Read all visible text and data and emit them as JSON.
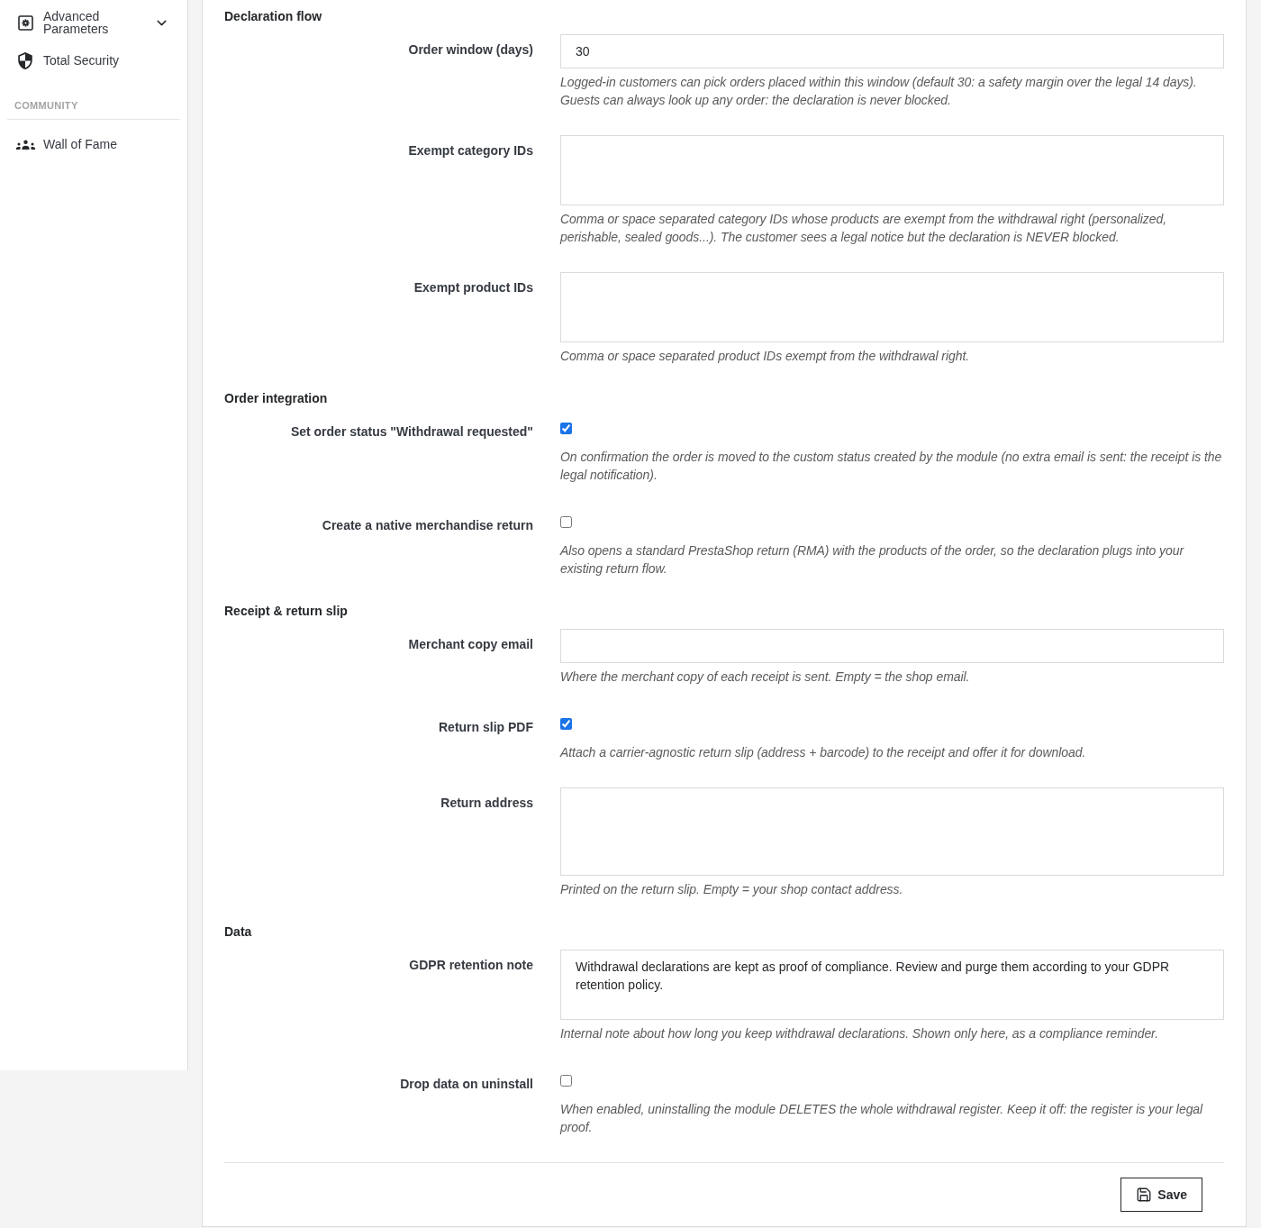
{
  "sidebar": {
    "items": [
      {
        "label": "Advanced Parameters",
        "kind": "group"
      },
      {
        "label": "Total Security",
        "kind": "link"
      }
    ],
    "sections": [
      {
        "title": "COMMUNITY",
        "items": [
          {
            "label": "Wall of Fame",
            "kind": "link"
          }
        ]
      }
    ]
  },
  "form": {
    "sections": [
      {
        "title": "Declaration flow",
        "fields": [
          {
            "label": "Order window (days)",
            "kind": "input",
            "value": "30",
            "help": "Logged-in customers can pick orders placed within this window (default 30: a safety margin over the legal 14 days). Guests can always look up any order: the declaration is never blocked."
          },
          {
            "label": "Exempt category IDs",
            "kind": "textarea",
            "help": "Comma or space separated category IDs whose products are exempt from the withdrawal right (personalized, perishable, sealed goods...). The customer sees a legal notice but the declaration is NEVER blocked."
          },
          {
            "label": "Exempt product IDs",
            "kind": "textarea",
            "help": "Comma or space separated product IDs exempt from the withdrawal right."
          }
        ]
      },
      {
        "title": "Order integration",
        "fields": [
          {
            "label": "Set order status \"Withdrawal requested\"",
            "kind": "checkbox",
            "checked": true,
            "help": "On confirmation the order is moved to the custom status created by the module (no extra email is sent: the receipt is the legal notification)."
          },
          {
            "label": "Create a native merchandise return",
            "kind": "checkbox",
            "checked": false,
            "help": "Also opens a standard PrestaShop return (RMA) with the products of the order, so the declaration plugs into your existing return flow."
          }
        ]
      },
      {
        "title": "Receipt & return slip",
        "fields": [
          {
            "label": "Merchant copy email",
            "kind": "input",
            "help": "Where the merchant copy of each receipt is sent. Empty = the shop email."
          },
          {
            "label": "Return slip PDF",
            "kind": "checkbox",
            "checked": true,
            "help": "Attach a carrier-agnostic return slip (address + barcode) to the receipt and offer it for download."
          },
          {
            "label": "Return address",
            "kind": "tall_textarea",
            "help": "Printed on the return slip. Empty = your shop contact address."
          }
        ]
      },
      {
        "title": "Data",
        "fields": [
          {
            "label": "GDPR retention note",
            "kind": "textarea",
            "value": "Withdrawal declarations are kept as proof of compliance. Review and purge them according to your GDPR retention policy.",
            "help": "Internal note about how long you keep withdrawal declarations. Shown only here, as a compliance reminder."
          },
          {
            "label": "Drop data on uninstall",
            "kind": "checkbox",
            "checked": false,
            "help": "When enabled, uninstalling the module DELETES the whole withdrawal register. Keep it off: the register is your legal proof."
          }
        ]
      }
    ],
    "save_button": "Save"
  }
}
